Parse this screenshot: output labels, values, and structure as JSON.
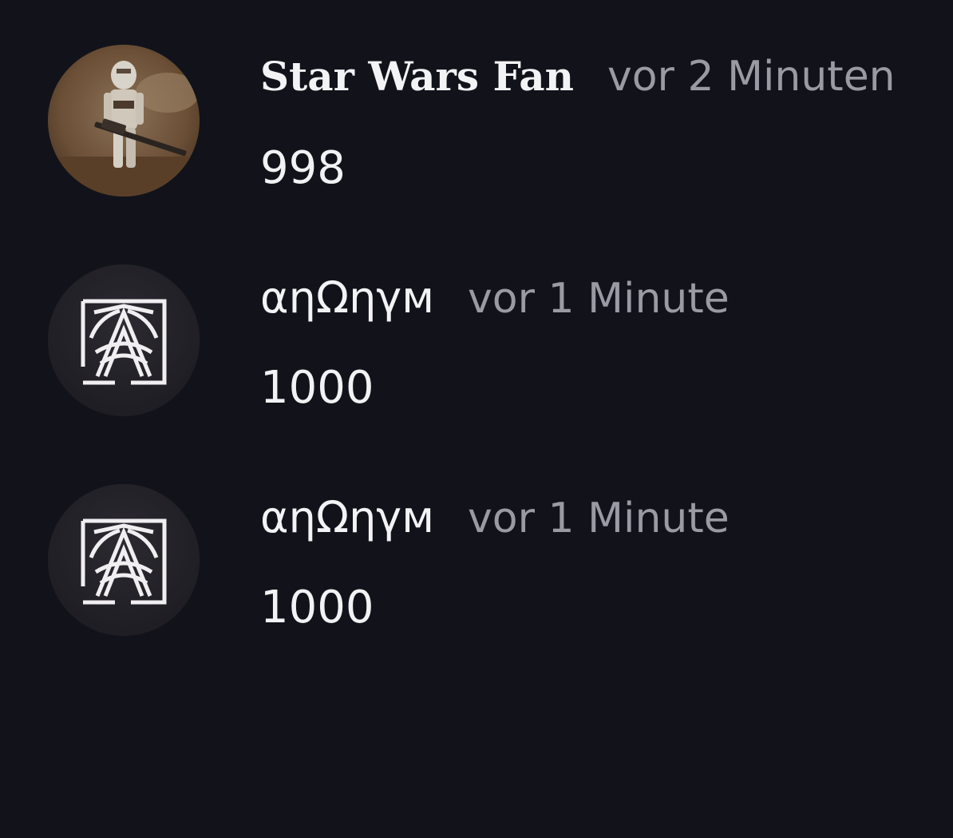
{
  "comments": [
    {
      "author": "Star Wars Fan",
      "time": "vor 2 Minuten",
      "text": "998",
      "avatar_icon": "clone-trooper-avatar"
    },
    {
      "author": "αηΩηγм",
      "time": "vor 1 Minute",
      "text": "1000",
      "avatar_icon": "anonym-logo-avatar"
    },
    {
      "author": "αηΩηγм",
      "time": "vor 1 Minute",
      "text": "1000",
      "avatar_icon": "anonym-logo-avatar"
    }
  ],
  "colors": {
    "background": "#12131a",
    "author": "#f3f3f6",
    "timestamp": "#9a9aa3",
    "text": "#f2f2f5"
  }
}
